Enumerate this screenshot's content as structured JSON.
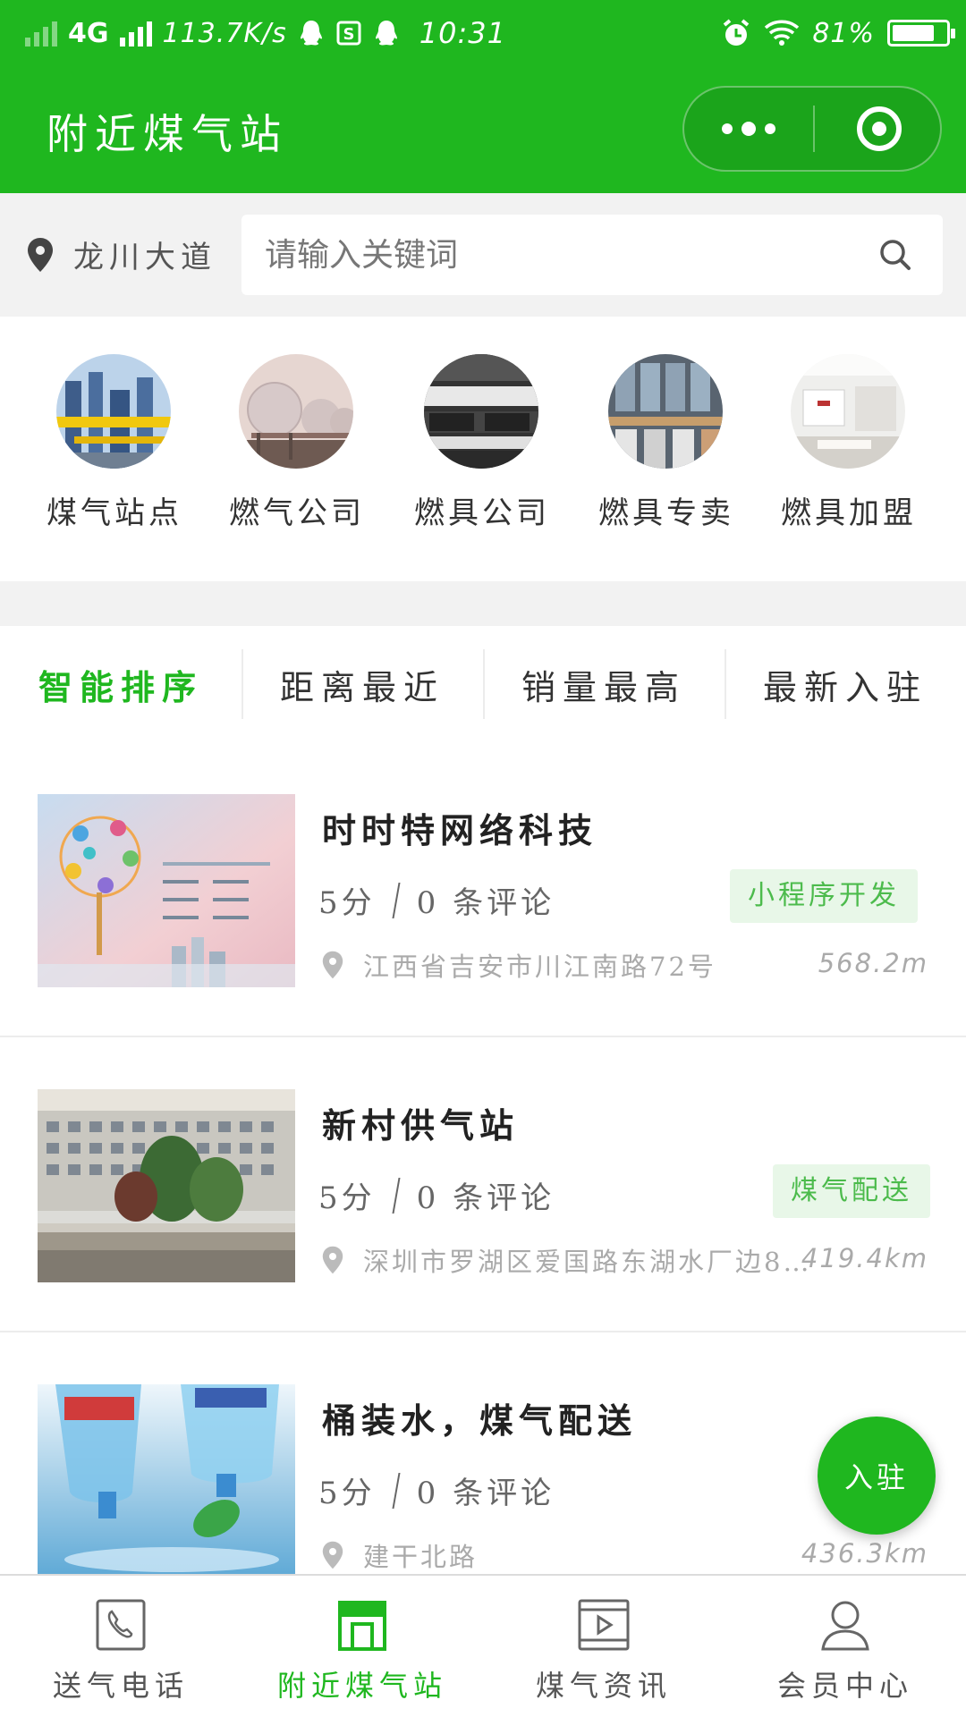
{
  "status_bar": {
    "network": "4G",
    "speed": "113.7K/s",
    "time": "10:31",
    "battery": "81%",
    "battery_level": 0.81
  },
  "header": {
    "title": "附近煤气站",
    "more_icon": "more-dots-icon",
    "close_icon": "target-close-icon"
  },
  "search": {
    "location": "龙川大道",
    "placeholder": "请输入关键词"
  },
  "categories": [
    {
      "label": "煤气站点",
      "icon": "gas-plant-photo"
    },
    {
      "label": "燃气公司",
      "icon": "gas-tanks-photo"
    },
    {
      "label": "燃具公司",
      "icon": "stove-photo"
    },
    {
      "label": "燃具专卖",
      "icon": "appliance-store-photo"
    },
    {
      "label": "燃具加盟",
      "icon": "showroom-photo"
    }
  ],
  "sort_tabs": [
    "智能排序",
    "距离最近",
    "销量最高",
    "最新入驻"
  ],
  "active_sort": 0,
  "listings": [
    {
      "name": "时时特网络科技",
      "score": "5分",
      "reviews": "0 条评论",
      "tag": "小程序开发",
      "address": "江西省吉安市川江南路72号",
      "distance": "568.2m"
    },
    {
      "name": "新村供气站",
      "score": "5分",
      "reviews": "0 条评论",
      "tag": "煤气配送",
      "address": "深圳市罗湖区爱国路东湖水厂边8…",
      "distance": "419.4km"
    },
    {
      "name": "桶装水，煤气配送",
      "score": "5分",
      "reviews": "0 条评论",
      "tag": "",
      "address": "建干北路",
      "distance": "436.3km"
    }
  ],
  "fab": {
    "label": "入驻"
  },
  "tabbar": [
    {
      "label": "送气电话",
      "icon": "phone-icon"
    },
    {
      "label": "附近煤气站",
      "icon": "store-icon"
    },
    {
      "label": "煤气资讯",
      "icon": "video-icon"
    },
    {
      "label": "会员中心",
      "icon": "user-icon"
    }
  ],
  "active_tab": 1,
  "colors": {
    "brand": "#1fb71f",
    "tag_bg": "#e8f7e8",
    "tag_text": "#4cbb4c"
  }
}
